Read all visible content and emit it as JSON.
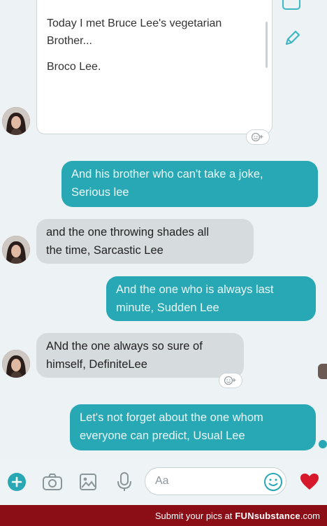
{
  "card": {
    "line1": "Today I met Bruce Lee's vegetarian",
    "line2": "Brother...",
    "line3": "Broco Lee."
  },
  "messages": [
    {
      "dir": "out",
      "line1": "And his brother who can't take a joke,",
      "line2": "Serious lee"
    },
    {
      "dir": "in",
      "line1": "and the one throwing shades all",
      "line2": "the time, Sarcastic Lee"
    },
    {
      "dir": "out",
      "line1": "And the one who is always last",
      "line2": "minute, Sudden Lee"
    },
    {
      "dir": "in",
      "line1": "ANd the one always so sure of",
      "line2": "himself, DefiniteLee"
    },
    {
      "dir": "out",
      "line1": "Let's not forget about the one whom",
      "line2": "everyone can predict, Usual Lee"
    }
  ],
  "composer": {
    "placeholder": "Aa",
    "icons": [
      "plus-icon",
      "camera-icon",
      "image-icon",
      "mic-icon",
      "emoji-icon",
      "heart-icon"
    ]
  },
  "footer": {
    "text": "Submit your pics at",
    "brand": "FUNsubstance",
    "domain": ".com"
  },
  "colors": {
    "outgoing_bubble": "#27a8b4",
    "incoming_bubble": "#d6dbde",
    "accent": "#3db7c3",
    "footer_bg": "#8b0d16",
    "heart": "#d7192c"
  }
}
